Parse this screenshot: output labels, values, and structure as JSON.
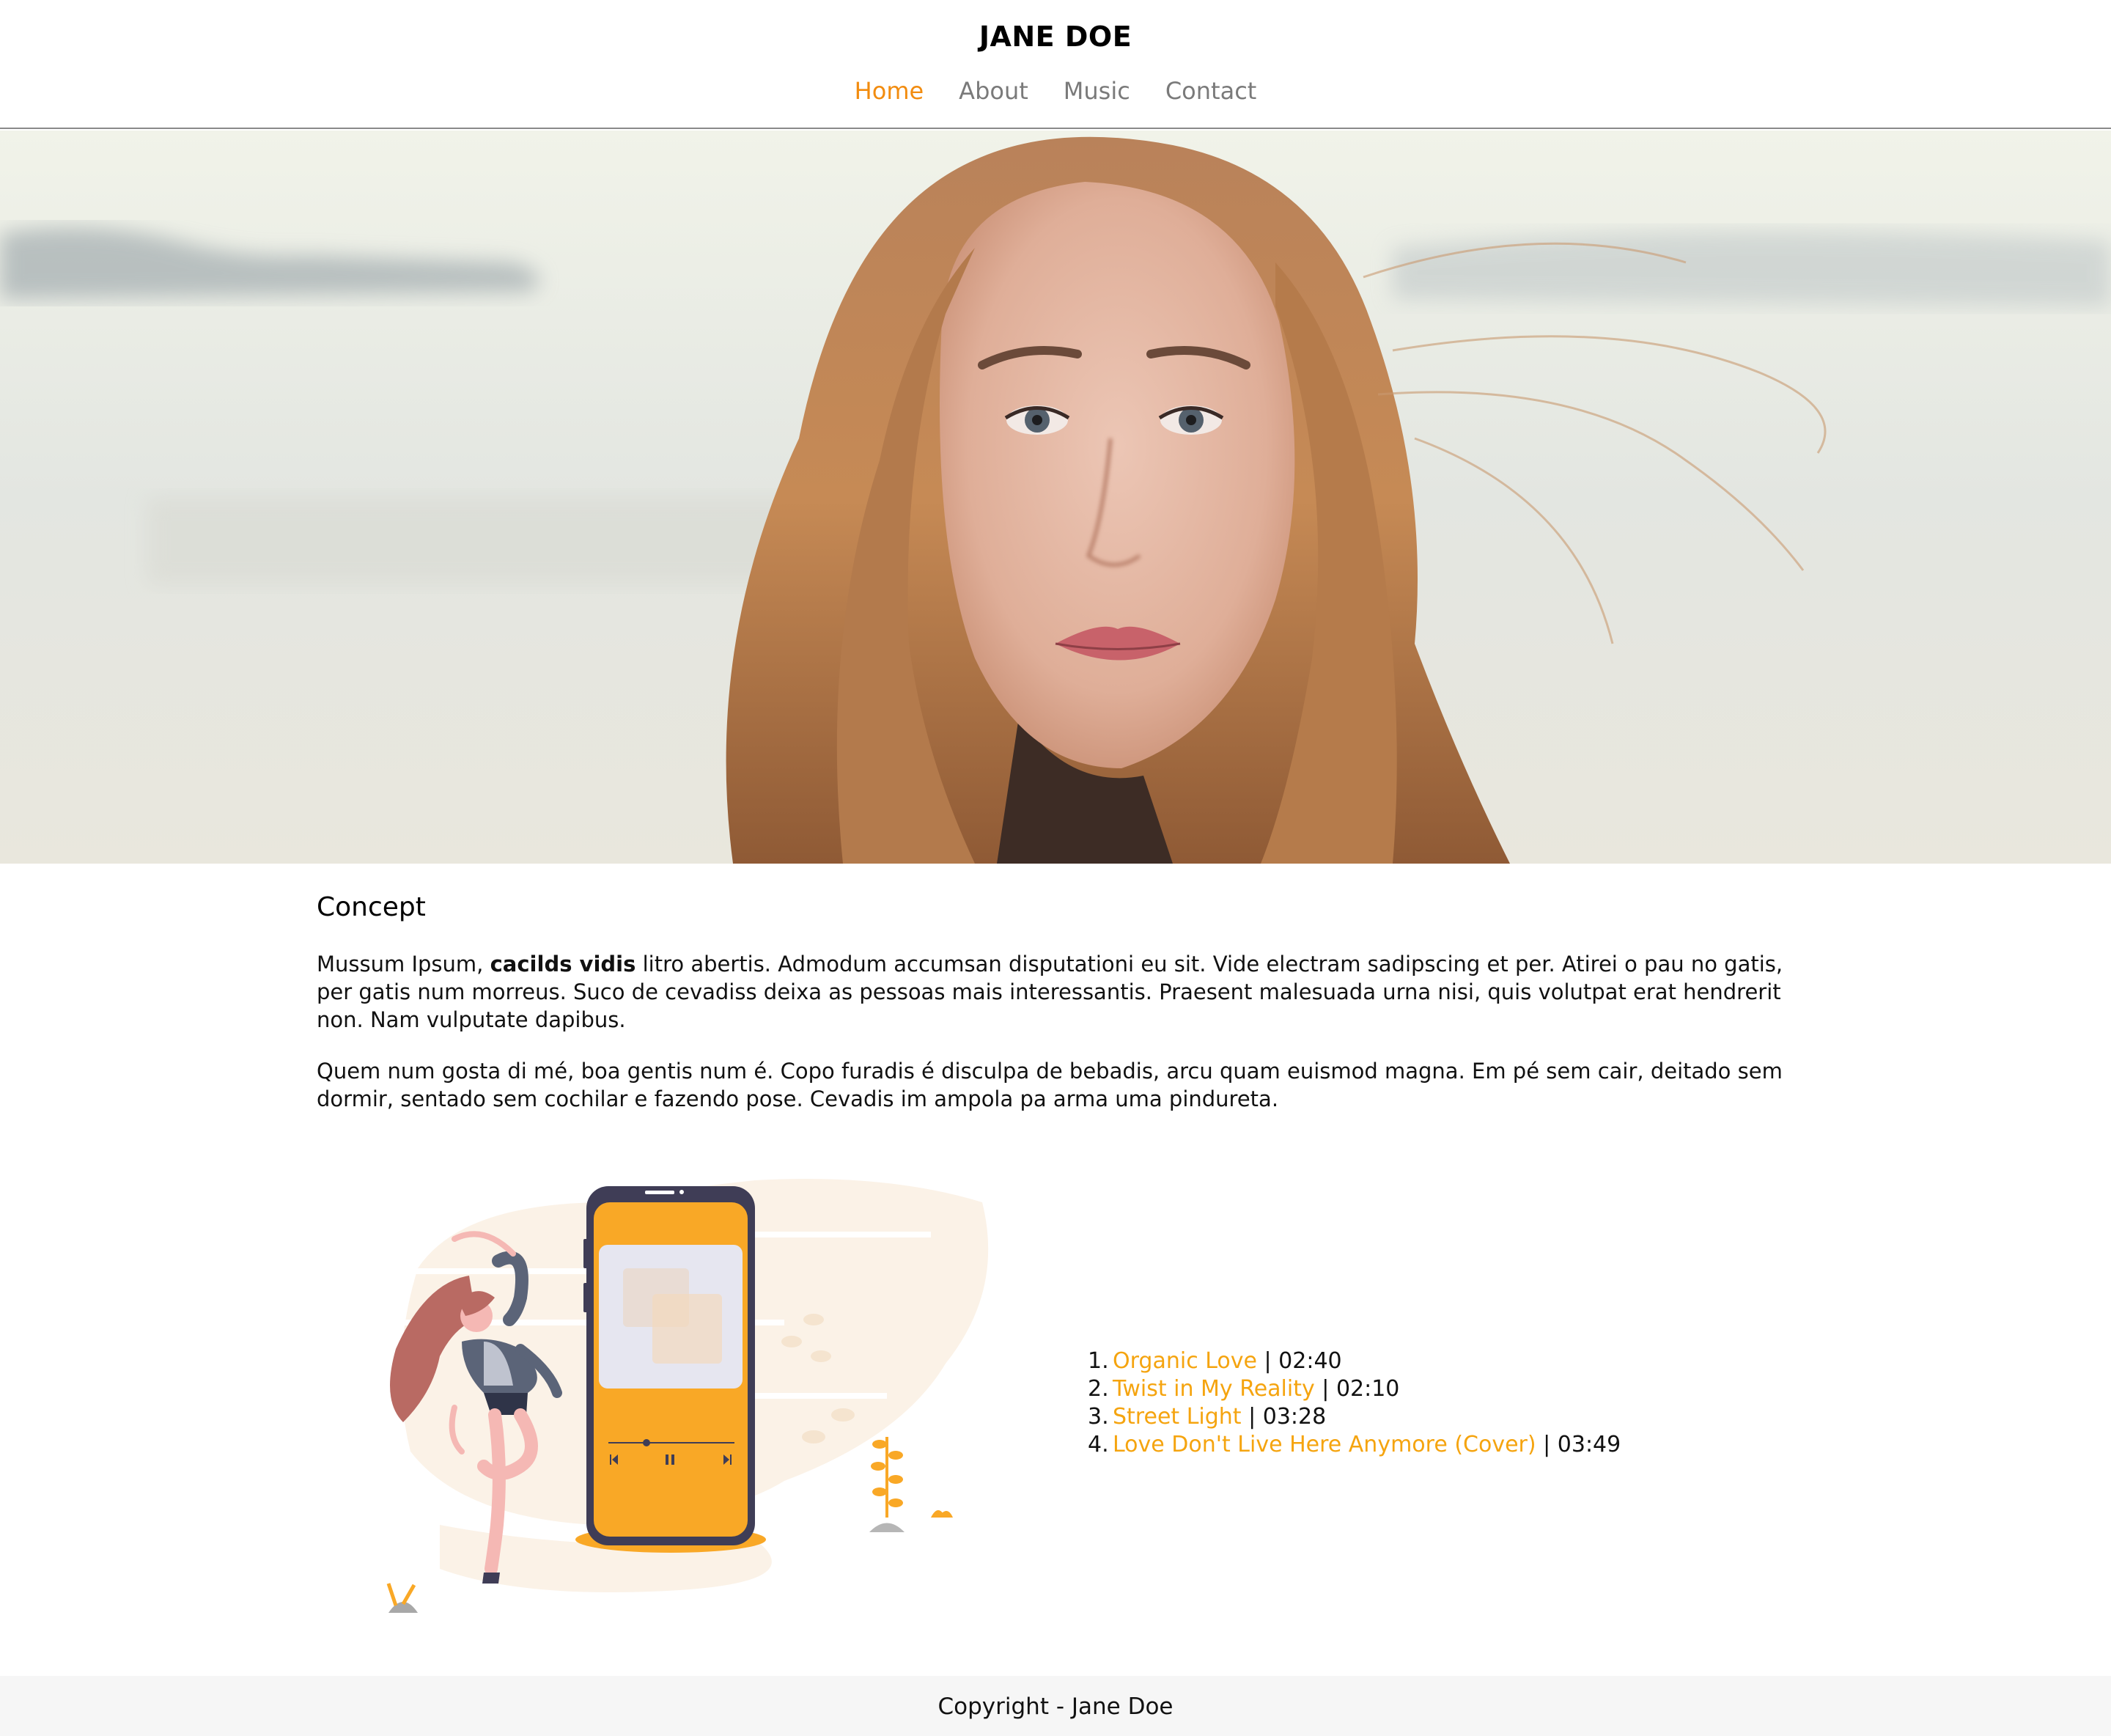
{
  "header": {
    "title": "JANE DOE",
    "nav": [
      {
        "label": "Home",
        "active": true
      },
      {
        "label": "About",
        "active": false
      },
      {
        "label": "Music",
        "active": false
      },
      {
        "label": "Contact",
        "active": false
      }
    ]
  },
  "hero": {
    "image": "portrait-photo"
  },
  "concept": {
    "title": "Concept",
    "paragraph1": {
      "before": "Mussum Ipsum, ",
      "strong": "cacilds vidis",
      "after": " litro abertis. Admodum accumsan disputationi eu sit. Vide electram sadipscing et per. Atirei o pau no gatis, per gatis num morreus. Suco de cevadiss deixa as pessoas mais interessantis. Praesent malesuada urna nisi, quis volutpat erat hendrerit non. Nam vulputate dapibus."
    },
    "paragraph2": "Quem num gosta di mé, boa gentis num é. Copo furadis é disculpa de bebadis, arcu quam euismod magna. Em pé sem cair, deitado sem dormir, sentado sem cochilar e fazendo pose. Cevadis im ampola pa arma uma pindureta."
  },
  "music": {
    "illustration": "woman-dancing-with-phone-illustration",
    "tracks": [
      {
        "title": "Organic Love",
        "sep": " | ",
        "duration": "02:40"
      },
      {
        "title": "Twist in My Reality",
        "sep": " | ",
        "duration": "02:10"
      },
      {
        "title": "Street Light",
        "sep": " | ",
        "duration": "03:28"
      },
      {
        "title": "Love Don't Live Here Anymore (Cover)",
        "sep": " | ",
        "duration": "03:49"
      }
    ]
  },
  "footer": {
    "copyright": "Copyright - Jane Doe"
  },
  "colors": {
    "accent": "#f28c0f",
    "track_link": "#f5a40f",
    "phone_body": "#f9a826",
    "footer_bg": "#f6f6f6"
  }
}
